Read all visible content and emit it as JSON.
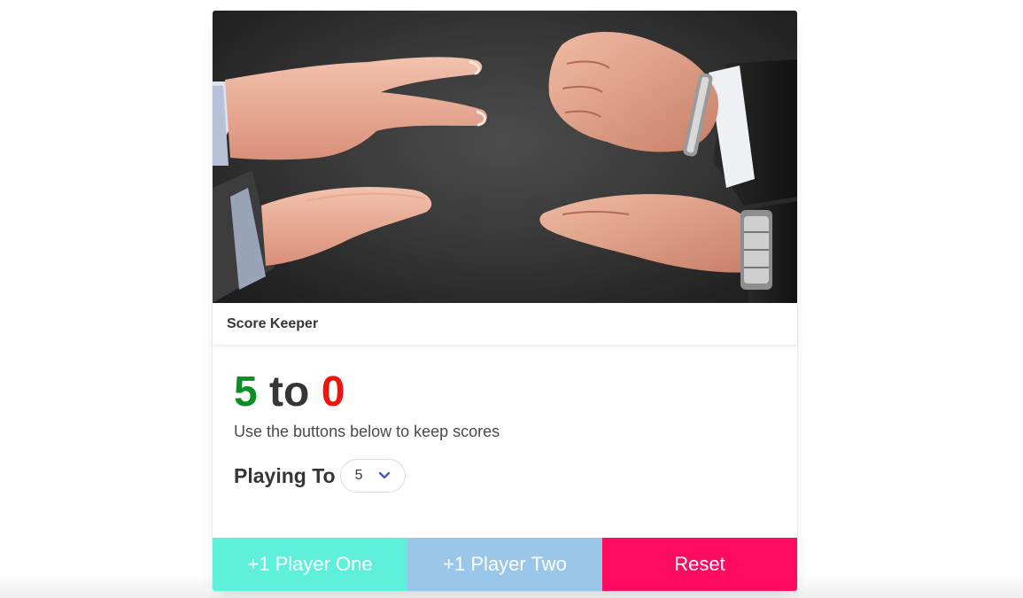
{
  "card": {
    "title": "Score Keeper"
  },
  "image": {
    "icon": "rock-paper-scissors-hands-photo"
  },
  "score": {
    "player_one": "5",
    "separator": "to",
    "player_two": "0",
    "player_one_color": "#0a8f24",
    "player_two_color": "#f2140c"
  },
  "instructions": "Use the buttons below to keep scores",
  "playing_to": {
    "label": "Playing To",
    "selected": "5"
  },
  "buttons": {
    "player_one": "+1 Player One",
    "player_two": "+1 Player Two",
    "reset": "Reset",
    "player_one_color": "#5ef0db",
    "player_two_color": "#99c6e9",
    "reset_color": "#ff0a5e"
  }
}
